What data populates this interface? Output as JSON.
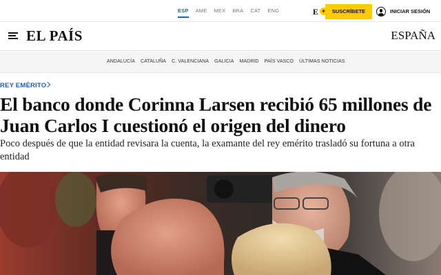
{
  "topbar": {
    "editions": [
      {
        "label": "ESP",
        "active": true
      },
      {
        "label": "AME",
        "active": false
      },
      {
        "label": "MEX",
        "active": false
      },
      {
        "label": "BRA",
        "active": false
      },
      {
        "label": "CAT",
        "active": false
      },
      {
        "label": "ENG",
        "active": false
      }
    ],
    "ecir_logo": "E",
    "ecir_plus": "+",
    "subscribe_label": "SUSCRÍBETE",
    "login_label": "INICIAR SESIÓN"
  },
  "masthead": {
    "logo": "EL PAÍS",
    "region": "ESPAÑA"
  },
  "subnav": {
    "items": [
      "ANDALUCÍA",
      "CATALUÑA",
      "C. VALENCIANA",
      "GALICIA",
      "MADRID",
      "PAÍS VASCO",
      "ÚLTIMAS NOTICIAS"
    ]
  },
  "article": {
    "kicker": "REY EMÉRITO",
    "headline": "El banco donde Corinna Larsen recibió 65 millones de Juan Carlos I cuestionó el origen del dinero",
    "subheadline": "Poco después de que la entidad revisara la cuenta, la examante del rey emérito trasladó su fortuna a otra entidad"
  },
  "colors": {
    "accent_blue": "#1a62c4",
    "subscribe_yellow": "#ffcc00",
    "subnav_bg": "#f5f5f5"
  }
}
